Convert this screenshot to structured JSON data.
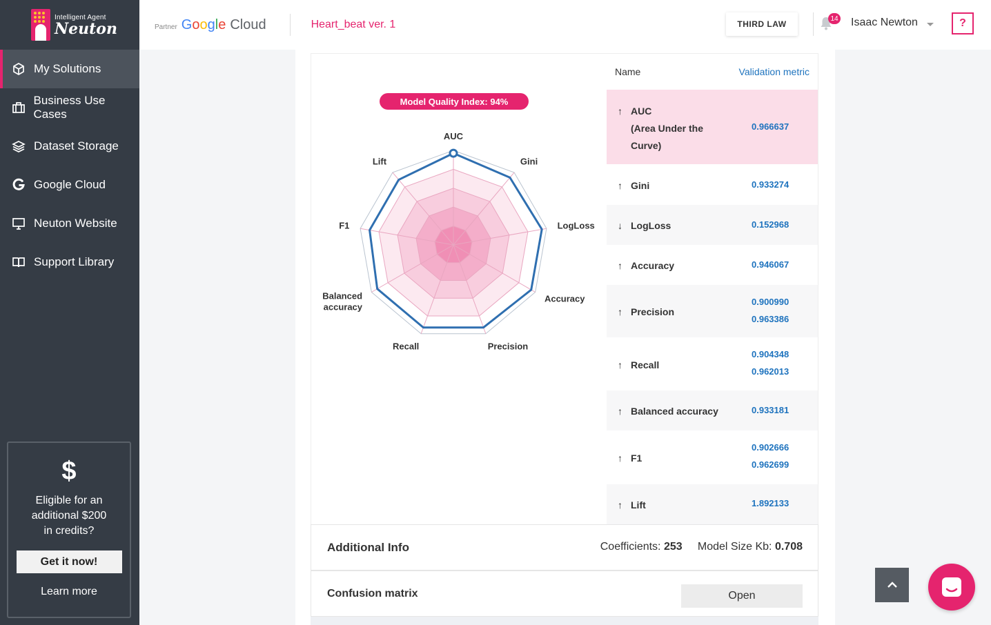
{
  "brand": {
    "tagline": "Intelligent Agent",
    "name": "Neuton",
    "accent": "#e5246e"
  },
  "sidebar": {
    "items": [
      {
        "label": "My Solutions",
        "icon": "cube-icon"
      },
      {
        "label": "Business Use Cases",
        "icon": "briefcase-icon"
      },
      {
        "label": "Dataset Storage",
        "icon": "layers-icon"
      },
      {
        "label": "Google Cloud",
        "icon": "google-g-icon"
      },
      {
        "label": "Neuton Website",
        "icon": "monitor-icon"
      },
      {
        "label": "Support Library",
        "icon": "book-icon"
      }
    ],
    "credit": {
      "symbol": "$",
      "text": "Eligible for an additional $200 in credits?",
      "button": "Get it now!",
      "link": "Learn more"
    }
  },
  "header": {
    "partner": "Partner",
    "google": {
      "g1": "G",
      "g2": "o",
      "g3": "o",
      "g1b": "g",
      "g4": "l",
      "g2b": "e",
      "cloud": "Cloud"
    },
    "project": "Heart_beat ver. 1",
    "third_law": "THIRD LAW",
    "notifications": "14",
    "user": "Isaac Newton",
    "help": "?"
  },
  "chart_data": {
    "type": "radar",
    "title": "Model Quality Index: 94%",
    "axes": [
      "AUC",
      "Gini",
      "LogLoss",
      "Accuracy",
      "Precision",
      "Recall",
      "Balanced accuracy",
      "F1",
      "Lift"
    ],
    "series": [
      {
        "values": [
          0.97,
          0.93,
          0.95,
          0.95,
          0.93,
          0.93,
          0.93,
          0.9,
          0.9
        ]
      }
    ],
    "rings": 5,
    "colors": {
      "line": "#2f6fb0",
      "fill": "#e5246e"
    }
  },
  "metrics": {
    "header": {
      "name": "Name",
      "value": "Validation metric"
    },
    "rows": [
      {
        "arrow": "↑",
        "name": "AUC",
        "name2": "(Area Under the",
        "name3": "Curve)",
        "v1": "0.966637",
        "v2": ""
      },
      {
        "arrow": "↑",
        "name": "Gini",
        "v1": "0.933274",
        "v2": ""
      },
      {
        "arrow": "↓",
        "name": "LogLoss",
        "v1": "0.152968",
        "v2": ""
      },
      {
        "arrow": "↑",
        "name": "Accuracy",
        "v1": "0.946067",
        "v2": ""
      },
      {
        "arrow": "↑",
        "name": "Precision",
        "v1": "0.900990",
        "v2": "0.963386"
      },
      {
        "arrow": "↑",
        "name": "Recall",
        "v1": "0.904348",
        "v2": "0.962013"
      },
      {
        "arrow": "↑",
        "name": "Balanced accuracy",
        "v1": "0.933181",
        "v2": ""
      },
      {
        "arrow": "↑",
        "name": "F1",
        "v1": "0.902666",
        "v2": "0.962699"
      },
      {
        "arrow": "↑",
        "name": "Lift",
        "v1": "1.892133",
        "v2": ""
      }
    ]
  },
  "additional": {
    "title": "Additional Info",
    "coef_label": "Coefficients:",
    "coef": "253",
    "size_label": "Model Size Kb:",
    "size": "0.708"
  },
  "confusion": {
    "title": "Confusion matrix",
    "button": "Open"
  }
}
